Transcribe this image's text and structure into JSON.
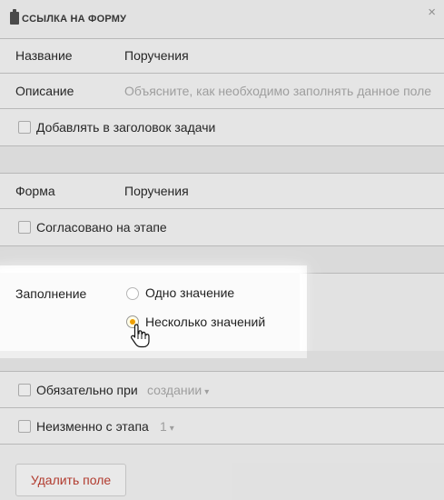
{
  "header": {
    "title": "ССЫЛКА НА ФОРМУ",
    "close": "×"
  },
  "fields": {
    "name_label": "Название",
    "name_value": "Поручения",
    "description_label": "Описание",
    "description_placeholder": "Объясните, как необходимо заполнять данное поле",
    "add_to_title_label": "Добавлять в заголовок задачи",
    "form_label": "Форма",
    "form_value": "Поручения",
    "approved_label": "Согласовано на этапе",
    "fill_label": "Заполнение",
    "fill_options": [
      "Одно значение",
      "Несколько значений"
    ],
    "fill_selected": "Несколько значений",
    "required_label": "Обязательно при",
    "required_value": "создании",
    "unchanged_label": "Неизменно с этапа",
    "unchanged_value": "1"
  },
  "footer": {
    "delete_label": "Удалить поле"
  }
}
